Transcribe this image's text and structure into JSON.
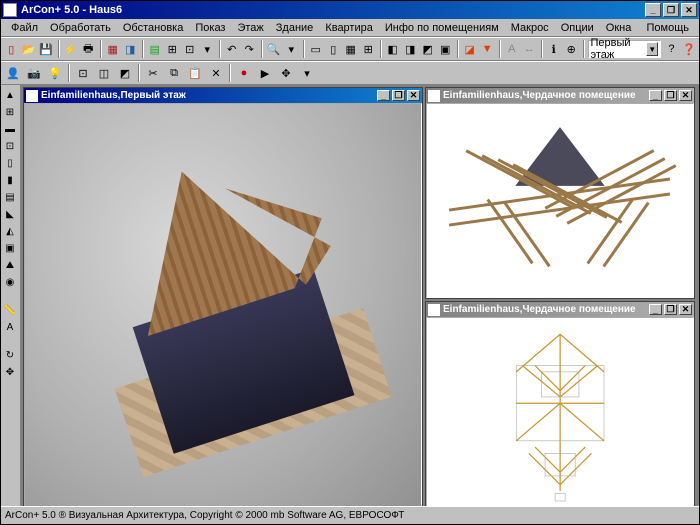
{
  "title": "ArCon+  5.0 - Haus6",
  "menu": {
    "file": "Файл",
    "edit": "Обработать",
    "situation": "Обстановка",
    "show": "Показ",
    "floor": "Этаж",
    "building": "Здание",
    "apartment": "Квартира",
    "roominfo": "Инфо по помещениям",
    "macros": "Макрос",
    "options": "Опции",
    "windows": "Окна",
    "help": "Помощь"
  },
  "toolbar": {
    "floor_selector": "Первый этаж"
  },
  "viewports": {
    "main": {
      "title": "Einfamilienhaus,Первый этаж"
    },
    "top_right": {
      "title": "Einfamilienhaus,Чердачное помещение"
    },
    "bottom_right": {
      "title": "Einfamilienhaus,Чердачное помещение"
    }
  },
  "status": "ArCon+ 5.0 ® Визуальная Архитектура, Copyright © 2000 mb Software AG, ЕВРОСОФТ",
  "icons": {
    "new": "▢",
    "open": "📂",
    "save": "💾",
    "print": "🖶",
    "undo": "↶",
    "redo": "↷",
    "cut": "✂",
    "copy": "⧉",
    "paste": "📋",
    "grid": "▦",
    "snap": "⊞",
    "zoom": "🔍",
    "pan": "✥",
    "wall": "▬",
    "window": "⊡",
    "door": "▯",
    "roof": "◣",
    "stairs": "▤",
    "3d": "◨",
    "layers": "≣",
    "measure": "📏"
  }
}
